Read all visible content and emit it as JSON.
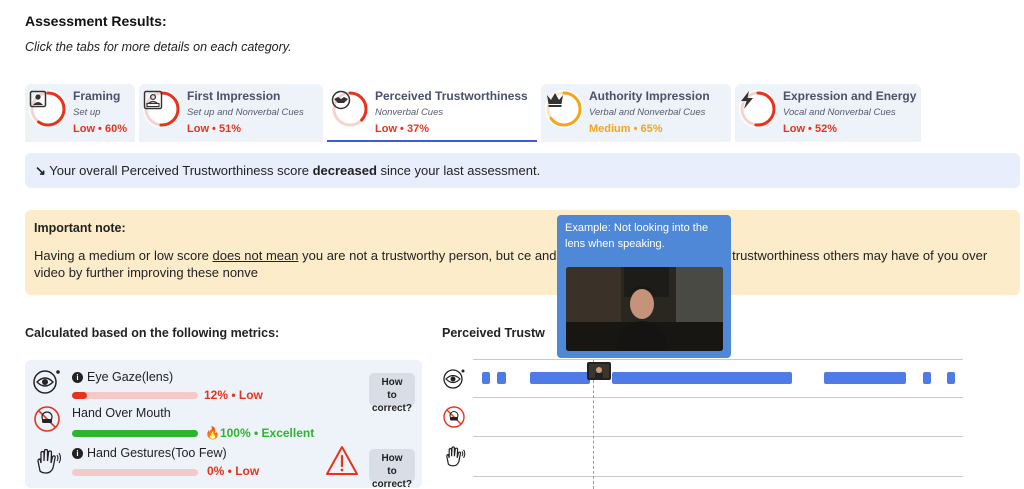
{
  "header": {
    "title": "Assessment Results:",
    "subtitle": "Click the tabs for more details on each category."
  },
  "tabs": [
    {
      "name": "Framing",
      "sub": "Set up",
      "score": "Low • 60%",
      "level": "low",
      "percent": 60,
      "icon": "portrait-frame-icon",
      "active": false
    },
    {
      "name": "First Impression",
      "sub": "Set up and Nonverbal Cues",
      "score": "Low • 51%",
      "level": "low",
      "percent": 51,
      "icon": "person-at-desk-icon",
      "active": false
    },
    {
      "name": "Perceived Trustworthiness",
      "sub": "Nonverbal Cues",
      "score": "Low • 37%",
      "level": "low",
      "percent": 37,
      "icon": "handshake-icon",
      "active": true
    },
    {
      "name": "Authority Impression",
      "sub": "Verbal and Nonverbal Cues",
      "score": "Medium • 65%",
      "level": "medium",
      "percent": 65,
      "icon": "crown-icon",
      "active": false
    },
    {
      "name": "Expression and Energy",
      "sub": "Vocal and Nonverbal Cues",
      "score": "Low • 52%",
      "level": "low",
      "percent": 52,
      "icon": "lightning-icon",
      "active": false
    }
  ],
  "colors": {
    "low": "#e8331c",
    "medium": "#f4a51c",
    "excellent": "#2db52d",
    "accent": "#3b5bdb",
    "timeline_bar": "#4f7be6",
    "tooltip_bg": "#4f88d6"
  },
  "infobar": {
    "icon": "trend-down-icon",
    "before": "Your overall Perceived Trustworthiness score",
    "bold": "decreased",
    "after": "since your last assessment."
  },
  "note": {
    "title": "Important note:",
    "body_before": "Having a medium or low score",
    "body_underline": "does not mean",
    "body_after": "you are not a trustworthy person, but",
    "body_hidden": "ce and encourage the perceptions of trustworthiness others may have of you over video by further improving these nonve"
  },
  "metrics": {
    "title": "Calculated based on the following metrics:",
    "items": [
      {
        "name": "Eye Gaze(lens)",
        "score": "12% • Low",
        "value": 12,
        "level": "low",
        "icon": "eye-icon",
        "how": "How to correct?",
        "warning": false
      },
      {
        "name": "Hand Over Mouth",
        "score": "100% • Excellent",
        "value": 100,
        "level": "excellent",
        "icon": "hand-over-mouth-icon",
        "how": "",
        "warning": false
      },
      {
        "name": "Hand Gestures(Too Few)",
        "score": "0% • Low",
        "value": 0,
        "level": "low",
        "icon": "waving-hand-icon",
        "how": "How to correct?",
        "warning": true
      }
    ]
  },
  "timeline": {
    "title": "Perceived Trustw"
  },
  "tooltip": {
    "text": "Example: Not looking into the lens when speaking."
  }
}
